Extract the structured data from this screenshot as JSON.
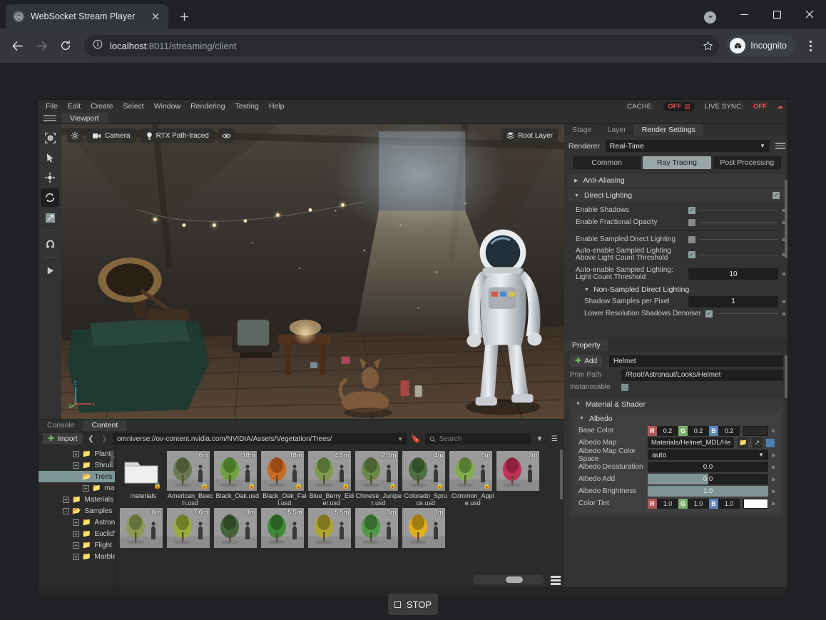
{
  "browser": {
    "tab": {
      "title": "WebSocket Stream Player",
      "favicon": "globe-icon",
      "close": "×"
    },
    "new_tab": "+",
    "window_controls": {
      "minimize": "—",
      "maximize": "▢",
      "close": "✕"
    },
    "nav": {
      "back": "←",
      "forward": "→",
      "reload": "⟳",
      "site_info": "ⓘ"
    },
    "address": {
      "host": "localhost",
      "rest": ":8011/streaming/client"
    },
    "star": "☆",
    "profile": {
      "label": "Incognito",
      "icon": "incognito-icon"
    },
    "menu": "kebab-menu-icon"
  },
  "omniverse": {
    "menubar": [
      "File",
      "Edit",
      "Create",
      "Select",
      "Window",
      "Rendering",
      "Testing",
      "Help"
    ],
    "status": {
      "cache_label": "CACHE:",
      "cache_value": "OFF",
      "live_sync_label": "LIVE SYNC:",
      "live_sync_value": "OFF"
    },
    "viewport": {
      "tab": "Viewport",
      "toolbar": {
        "settings": "gear-icon",
        "camera": "Camera",
        "renderer": "RTX Path-traced",
        "visibility": "eye-icon"
      },
      "root_layer": "Root Layer",
      "axis": {
        "x": "x",
        "y": "y",
        "z": "z"
      },
      "tools": [
        "select-box-icon",
        "cursor-arrow-icon",
        "move-icon",
        "rotate-icon",
        "scale-icon",
        "snap-magnet-icon",
        "play-icon"
      ]
    },
    "render_settings": {
      "tabs": [
        "Stage",
        "Layer",
        "Render Settings"
      ],
      "active_tab": "Render Settings",
      "renderer_label": "Renderer",
      "renderer_value": "Real-Time",
      "segments": [
        "Common",
        "Ray Tracing",
        "Post Processing"
      ],
      "active_segment": "Ray Tracing",
      "sections": [
        {
          "title": "Anti-Aliasing",
          "expanded": false,
          "checked": null
        },
        {
          "title": "Direct Lighting",
          "expanded": true,
          "checked": true
        }
      ],
      "rows": [
        {
          "label": "Enable Shadows",
          "type": "checkbox",
          "value": true
        },
        {
          "label": "Enable Fractional Opacity",
          "type": "checkbox",
          "value": false
        },
        {
          "label": "Enable Sampled Direct Lighting",
          "type": "checkbox",
          "value": false
        },
        {
          "label": "Auto-enable Sampled Lighting Above Light Count Threshold",
          "type": "checkbox",
          "value": true
        },
        {
          "label": "Auto-enable Sampled Lighting: Light Count Threshold",
          "type": "number",
          "value": "10"
        }
      ],
      "subsection": "Non-Sampled Direct Lighting",
      "sub_rows": [
        {
          "label": "Shadow Samples per Pixel",
          "type": "number",
          "value": "1"
        },
        {
          "label": "Lower Resolution Shadows Denoiser",
          "type": "checkbox",
          "value": true
        }
      ]
    },
    "property": {
      "tab": "Property",
      "add_label": "Add",
      "name_value": "Helmet",
      "prim_path_label": "Prim Path",
      "prim_path_value": "/Root/Astronaut/Looks/Helmet",
      "instanceable_label": "Instanceable",
      "instanceable_value": false,
      "material_shader": "Material & Shader",
      "albedo": "Albedo",
      "rows": [
        {
          "label": "Base Color",
          "type": "rgb",
          "r": "0.2",
          "g": "0.2",
          "b": "0.2",
          "swatch": "#2a2a2a"
        },
        {
          "label": "Albedo Map",
          "type": "path",
          "value": "Materials/Helmet_MDL/He"
        },
        {
          "label": "Albedo Map Color Space",
          "type": "combo",
          "value": "auto"
        },
        {
          "label": "Albedo Desaturation",
          "type": "number",
          "value": "0.0",
          "fill": 0
        },
        {
          "label": "Albedo Add",
          "type": "slider",
          "value": "0.0",
          "fill": 50
        },
        {
          "label": "Albedo Brightness",
          "type": "slider",
          "value": "1.0",
          "fill": 100
        },
        {
          "label": "Color Tint",
          "type": "rgb",
          "r": "1.0",
          "g": "1.0",
          "b": "1.0",
          "swatch": "#ffffff"
        }
      ]
    },
    "content": {
      "tabs": [
        "Console",
        "Content"
      ],
      "active_tab": "Content",
      "import_label": "Import",
      "path": "omniverse://ov-content.nvidia.com/NVIDIA/Assets/Vegetation/Trees/",
      "search_placeholder": "Search",
      "tree": [
        {
          "label": "Plant_Tropical",
          "depth": 3,
          "state": "+",
          "selected": false
        },
        {
          "label": "Shrub",
          "depth": 3,
          "state": "+",
          "selected": false
        },
        {
          "label": "Trees",
          "depth": 3,
          "state": "-",
          "selected": true
        },
        {
          "label": "materials",
          "depth": 4,
          "state": "+",
          "selected": false
        },
        {
          "label": "Materials",
          "depth": 2,
          "state": "+",
          "selected": false
        },
        {
          "label": "Samples",
          "depth": 2,
          "state": "-",
          "selected": false
        },
        {
          "label": "Astronaut",
          "depth": 3,
          "state": "+",
          "selected": false
        },
        {
          "label": "EuclidVR",
          "depth": 3,
          "state": "+",
          "selected": false
        },
        {
          "label": "Flight",
          "depth": 3,
          "state": "+",
          "selected": false
        },
        {
          "label": "Marbles",
          "depth": 3,
          "state": "+",
          "selected": false
        }
      ],
      "assets": [
        {
          "name": "materials",
          "size": "",
          "kind": "folder",
          "locked": true,
          "c1": "#7ca05a",
          "c2": "#4d6b35"
        },
        {
          "name": "American_Beech.usd",
          "size": "6m",
          "kind": "tree",
          "locked": true,
          "c1": "#6b7a54",
          "c2": "#44502f"
        },
        {
          "name": "Black_Oak.usd",
          "size": "18m",
          "kind": "tree",
          "locked": true,
          "c1": "#6fa33e",
          "c2": "#3e6b22"
        },
        {
          "name": "Black_Oak_Fall.usd",
          "size": "18m",
          "kind": "tree",
          "locked": true,
          "c1": "#c96a22",
          "c2": "#8a3d11"
        },
        {
          "name": "Blue_Berry_Elder.usd",
          "size": "4.5m",
          "kind": "tree",
          "locked": true,
          "c1": "#7d9a52",
          "c2": "#4a6330"
        },
        {
          "name": "Chinese_Juniper.usd",
          "size": "2.1m",
          "kind": "tree",
          "locked": true,
          "c1": "#6a8a4a",
          "c2": "#41572c"
        },
        {
          "name": "Colorado_Spruce.usd",
          "size": "4m",
          "kind": "tree",
          "locked": true,
          "c1": "#4e7040",
          "c2": "#2d4526"
        },
        {
          "name": "Common_Apple.usd",
          "size": "6m",
          "kind": "tree",
          "locked": true,
          "c1": "#7fae4a",
          "c2": "#4b6a2b"
        },
        {
          "name": "",
          "size": "3m",
          "kind": "tree",
          "locked": false,
          "c1": "#c2305a",
          "c2": "#7d1b38"
        },
        {
          "name": "",
          "size": "6m",
          "kind": "tree",
          "locked": false,
          "c1": "#8c9a55",
          "c2": "#5a6434"
        },
        {
          "name": "",
          "size": "7.6m",
          "kind": "tree",
          "locked": false,
          "c1": "#9aac3e",
          "c2": "#616e26"
        },
        {
          "name": "",
          "size": "3m",
          "kind": "tree",
          "locked": false,
          "c1": "#46663a",
          "c2": "#2a3f22"
        },
        {
          "name": "",
          "size": "5.5m",
          "kind": "tree",
          "locked": false,
          "c1": "#3f8c38",
          "c2": "#255321"
        },
        {
          "name": "",
          "size": "5.5m",
          "kind": "tree",
          "locked": false,
          "c1": "#b0a62e",
          "c2": "#6e671c"
        },
        {
          "name": "",
          "size": "3m",
          "kind": "tree",
          "locked": false,
          "c1": "#4f9a46",
          "c2": "#2f5c2a"
        },
        {
          "name": "",
          "size": "3m",
          "kind": "tree",
          "locked": false,
          "c1": "#e0b01f",
          "c2": "#8d6d0f"
        }
      ]
    }
  },
  "player": {
    "stop_label": "STOP"
  }
}
